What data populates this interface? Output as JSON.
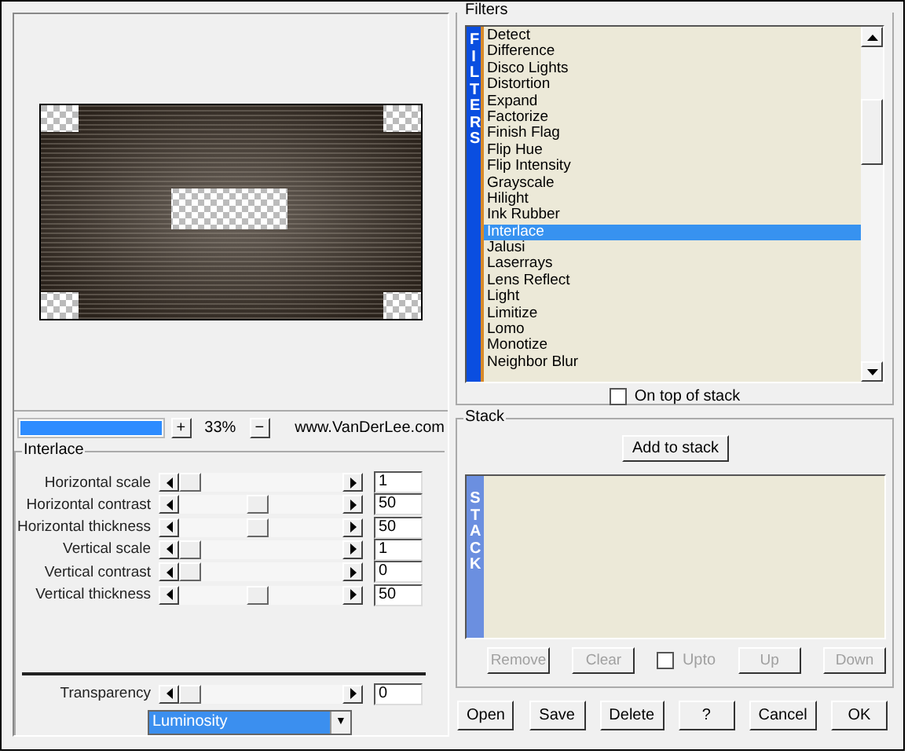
{
  "zoom": {
    "progress": {
      "level": 1
    },
    "plus": "+",
    "percent": "33%",
    "minus": "−",
    "website": "www.VanDerLee.com"
  },
  "interlace": {
    "title": "Interlace",
    "sliders": [
      {
        "label": "Horizontal scale",
        "level": 0,
        "value": "1"
      },
      {
        "label": "Horizontal contrast",
        "level": 0.5,
        "value": "50"
      },
      {
        "label": "Horizontal thickness",
        "level": 0.5,
        "value": "50"
      },
      {
        "label": "Vertical scale",
        "level": 0,
        "value": "1"
      },
      {
        "label": "Vertical contrast",
        "level": 0,
        "value": "0"
      },
      {
        "label": "Vertical thickness",
        "level": 0.5,
        "value": "50"
      }
    ]
  },
  "transparency": {
    "label": "Transparency",
    "level": 0,
    "value": "0"
  },
  "blend_mode": {
    "value": "Luminosity",
    "arrow": "▼"
  },
  "filters": {
    "title": "Filters",
    "strip": "FILTERS",
    "items": [
      {
        "label": "Detect",
        "selected": false
      },
      {
        "label": "Difference",
        "selected": false
      },
      {
        "label": "Disco Lights",
        "selected": false
      },
      {
        "label": "Distortion",
        "selected": false
      },
      {
        "label": "Expand",
        "selected": false
      },
      {
        "label": "Factorize",
        "selected": false
      },
      {
        "label": "Finish Flag",
        "selected": false
      },
      {
        "label": "Flip Hue",
        "selected": false
      },
      {
        "label": "Flip Intensity",
        "selected": false
      },
      {
        "label": "Grayscale",
        "selected": false
      },
      {
        "label": "Hilight",
        "selected": false
      },
      {
        "label": "Ink Rubber",
        "selected": false
      },
      {
        "label": "Interlace",
        "selected": true
      },
      {
        "label": "Jalusi",
        "selected": false
      },
      {
        "label": "Laserrays",
        "selected": false
      },
      {
        "label": "Lens Reflect",
        "selected": false
      },
      {
        "label": "Light",
        "selected": false
      },
      {
        "label": "Limitize",
        "selected": false
      },
      {
        "label": "Lomo",
        "selected": false
      },
      {
        "label": "Monotize",
        "selected": false
      },
      {
        "label": "Neighbor Blur",
        "selected": false
      }
    ],
    "on_top": {
      "label": "On top of stack",
      "checked": false
    }
  },
  "stack": {
    "title": "Stack",
    "add": "Add to stack",
    "strip": "STACK",
    "buttons": [
      {
        "label": "Remove",
        "disabled": true
      },
      {
        "label": "Clear",
        "disabled": true
      }
    ],
    "upto": {
      "label": "Upto",
      "checked": false,
      "disabled": true
    },
    "buttons2": [
      {
        "label": "Up",
        "disabled": true
      },
      {
        "label": "Down",
        "disabled": true
      }
    ]
  },
  "footer": [
    "Open",
    "Save",
    "Delete",
    "?",
    "Cancel",
    "OK"
  ]
}
